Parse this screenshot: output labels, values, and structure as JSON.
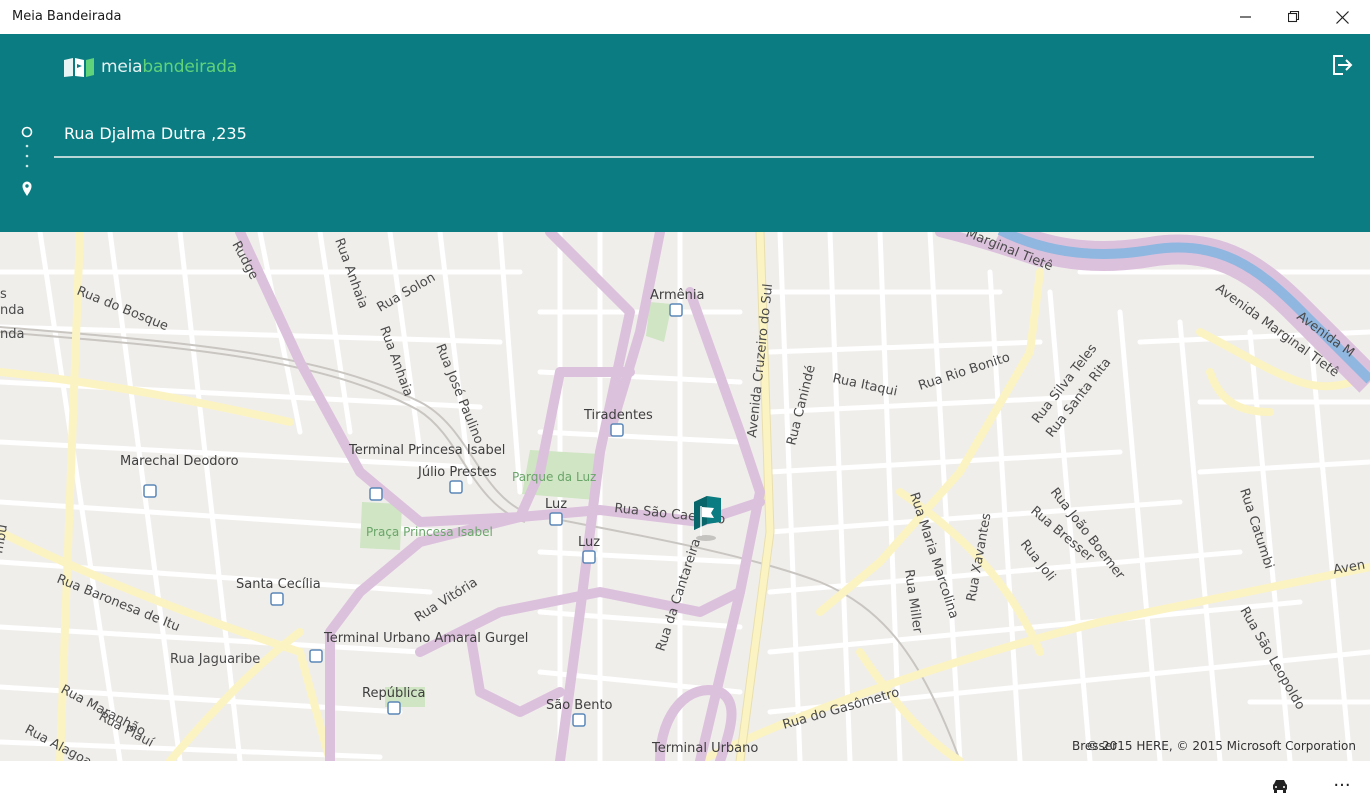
{
  "window": {
    "title": "Meia Bandeirada",
    "minimize_label": "Minimize",
    "maximize_label": "Restore",
    "close_label": "Close"
  },
  "header": {
    "logo_part1": "meia",
    "logo_part2": "bandeirada",
    "destination_value": "Rua Djalma Dutra ,235"
  },
  "map": {
    "street_labels": [
      "Rudge",
      "Rua Anhaia",
      "Rua Solon",
      "Rua do Bosque",
      "Rua Anhaia",
      "Rua José Paulino",
      "Avenida Cruzeiro do Sul",
      "Rua Canindé",
      "Rua Itaqui",
      "Rua Rio Bonito",
      "Rua Silva Teles",
      "Rua Santa Rita",
      "Marginal Tietê",
      "Avenida Marginal Tietê",
      "Avenida M",
      "Rua São Caetano",
      "Rua da Cantareira",
      "Rua Vitória",
      "Rua Baronesa de Itu",
      "Rua Jaguaribe",
      "Rua Maranhão",
      "Rua Piauí",
      "Rua Alagoas",
      "Rua Maria Marcolina",
      "Rua Miller",
      "Rua Joli",
      "Rua Bresser",
      "Rua João Boemer",
      "Rua Catumbi",
      "Rua São Leopoldo",
      "Rua do Gasômetro",
      "Rua Xavantes",
      "Aven",
      "nda",
      "nda",
      "s",
      "mbu"
    ],
    "poi_labels": [
      "Armênia",
      "Tiradentes",
      "Terminal Princesa Isabel",
      "Júlio Prestes",
      "Marechal Deodoro",
      "Luz",
      "Luz",
      "Santa Cecília",
      "Terminal Urbano Amaral Gurgel",
      "República",
      "São Bento",
      "Terminal Urbano"
    ],
    "park_labels": [
      "Parque da Luz",
      "Praça Princesa Isabel"
    ],
    "copyright": "© 2015 HERE, © 2015 Microsoft Corporation",
    "overlap_label": "Bresser",
    "colors": {
      "background": "#f0eeeb",
      "road": "#ffffff",
      "main_road": "#fbf3c2",
      "highway": "#dcc1dd",
      "river": "#8fb7e0",
      "park": "#cfe5c3",
      "flag": "#0b7d82"
    }
  },
  "bottombar": {
    "car_icon": "car-icon",
    "more_label": "···"
  },
  "icons": {
    "logo": "flag-logo-icon",
    "exit": "exit-icon",
    "origin": "origin-circle-icon",
    "destination": "location-pin-icon",
    "map_marker": "flag-marker-icon"
  }
}
